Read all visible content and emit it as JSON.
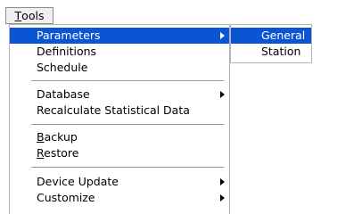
{
  "menubar": {
    "tools": {
      "mnemonic": "T",
      "rest": "ools"
    }
  },
  "menu": {
    "items": [
      {
        "label": "Parameters",
        "has_submenu": true,
        "selected": true
      },
      {
        "label": "Definitions"
      },
      {
        "label": "Schedule"
      },
      {
        "label": "Database",
        "has_submenu": true
      },
      {
        "label": "Recalculate Statistical Data"
      },
      {
        "mnemonic": "B",
        "rest": "ackup"
      },
      {
        "mnemonic": "R",
        "rest": "estore"
      },
      {
        "label": "Device Update",
        "has_submenu": true
      },
      {
        "label": "Customize",
        "has_submenu": true
      }
    ]
  },
  "submenu": {
    "items": [
      {
        "label": "General",
        "selected": true
      },
      {
        "label": "Station"
      }
    ]
  },
  "colors": {
    "highlight": "#0a55d4",
    "highlight_text": "#ffffff"
  }
}
